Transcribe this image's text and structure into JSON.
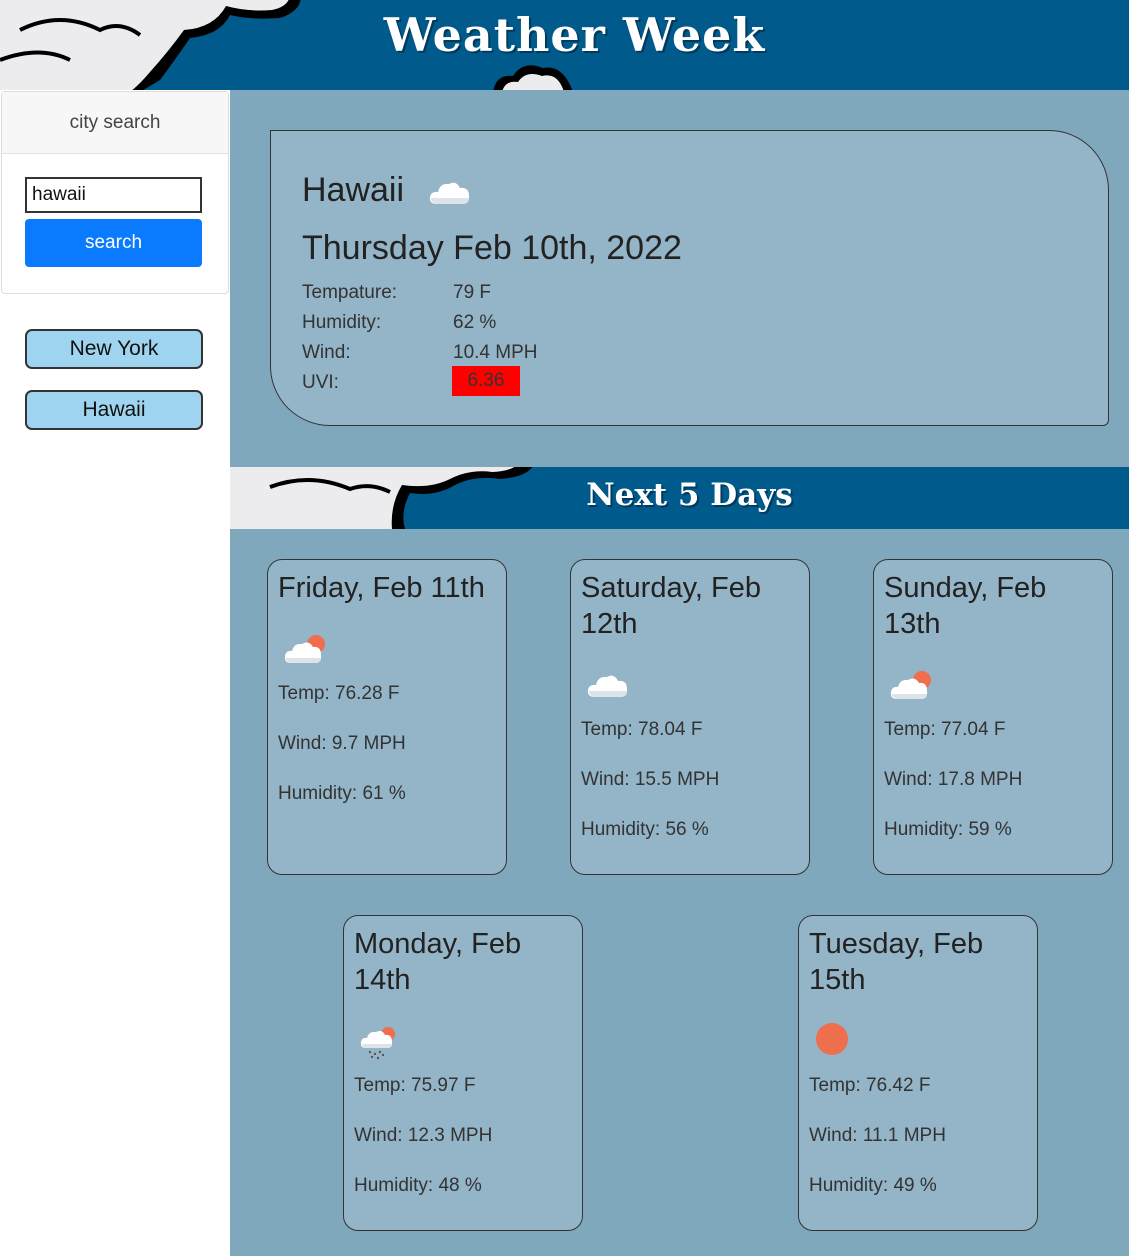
{
  "header": {
    "title": "Weather Week"
  },
  "sidebar": {
    "search_card_title": "city search",
    "search_value": "hawaii",
    "search_button": "search",
    "history": [
      "New York",
      "Hawaii"
    ]
  },
  "current": {
    "city": "Hawaii",
    "icon": "cloud-icon",
    "date": "Thursday Feb 10th, 2022",
    "labels": {
      "temp": "Tempature:",
      "humidity": "Humidity:",
      "wind": "Wind:",
      "uvi": "UVI:"
    },
    "values": {
      "temp": "79 F",
      "humidity": "62 %",
      "wind": "10.4 MPH",
      "uvi": "6.36"
    },
    "uvi_color": "#ff0000"
  },
  "forecast": {
    "title": "Next 5 Days",
    "days": [
      {
        "date": "Friday, Feb 11th",
        "icon": "partly-cloudy-icon",
        "temp": "Temp: 76.28 F",
        "wind": "Wind: 9.7 MPH",
        "humidity": "Humidity: 61 %"
      },
      {
        "date": "Saturday, Feb 12th",
        "icon": "cloud-icon",
        "temp": "Temp: 78.04 F",
        "wind": "Wind: 15.5 MPH",
        "humidity": "Humidity: 56 %"
      },
      {
        "date": "Sunday, Feb 13th",
        "icon": "partly-cloudy-icon",
        "temp": "Temp: 77.04 F",
        "wind": "Wind: 17.8 MPH",
        "humidity": "Humidity: 59 %"
      },
      {
        "date": "Monday, Feb 14th",
        "icon": "rain-sun-icon",
        "temp": "Temp: 75.97 F",
        "wind": "Wind: 12.3 MPH",
        "humidity": "Humidity: 48 %"
      },
      {
        "date": "Tuesday, Feb 15th",
        "icon": "sun-icon",
        "temp": "Temp: 76.42 F",
        "wind": "Wind: 11.1 MPH",
        "humidity": "Humidity: 49 %"
      }
    ]
  },
  "colors": {
    "header": "#005a8b",
    "main_bg": "#80a8bd",
    "card_bg": "#94b5c7",
    "search_button": "#0a7bff",
    "history_button": "#9fd4f0",
    "sun": "#ee6e4e"
  }
}
